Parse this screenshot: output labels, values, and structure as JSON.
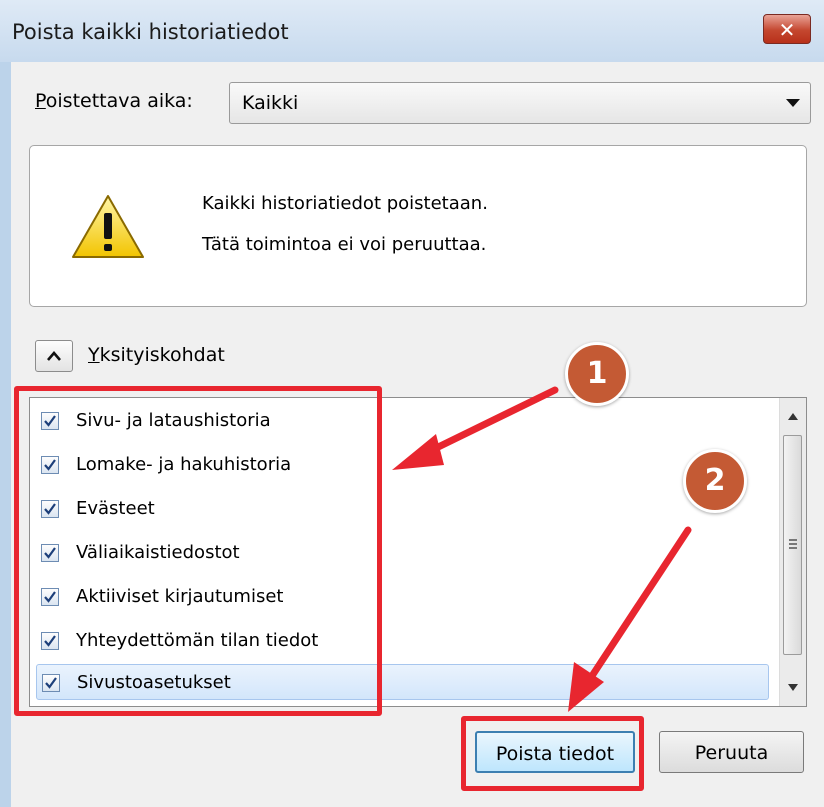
{
  "window": {
    "title": "Poista kaikki historiatiedot",
    "close_glyph": "✕"
  },
  "time_range": {
    "label_accel": "P",
    "label_rest": "oistettava aika:",
    "selected": "Kaikki"
  },
  "warning": {
    "line1": "Kaikki historiatiedot poistetaan.",
    "line2": "Tätä toimintoa ei voi peruuttaa."
  },
  "details": {
    "label_accel": "Y",
    "label_rest": "ksityiskohdat",
    "expanded": true
  },
  "items": [
    {
      "label": "Sivu- ja lataushistoria",
      "checked": true
    },
    {
      "label": "Lomake- ja hakuhistoria",
      "checked": true
    },
    {
      "label": "Evästeet",
      "checked": true
    },
    {
      "label": "Väliaikaistiedostot",
      "checked": true
    },
    {
      "label": "Aktiiviset kirjautumiset",
      "checked": true
    },
    {
      "label": "Yhteydettömän tilan tiedot",
      "checked": true
    },
    {
      "label": "Sivustoasetukset",
      "checked": true,
      "selected": true
    }
  ],
  "buttons": {
    "clear": "Poista tiedot",
    "cancel": "Peruuta"
  },
  "annotations": {
    "step1": "1",
    "step2": "2",
    "highlight_color": "#e8262f",
    "badge_color": "#c45a34"
  }
}
